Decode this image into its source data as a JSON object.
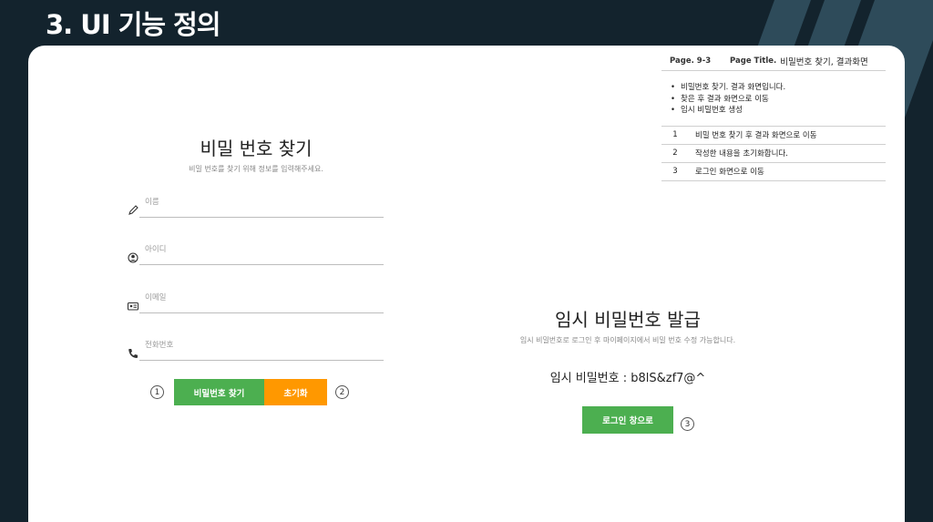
{
  "page_heading": "3. UI 기능 정의",
  "spec": {
    "page_label": "Page. 9-3",
    "page_title_label": "Page Title.",
    "page_title": "비밀번호 찾기, 결과화면",
    "notes": [
      "비밀번호 찾기. 결과 화면입니다.",
      "찾은 후 결과 화면으로 이동",
      "임시 비밀번호 생성"
    ],
    "rows": [
      {
        "num": "1",
        "desc": "비밀 번호 찾기 후 결과 화면으로 이동"
      },
      {
        "num": "2",
        "desc": "작성한 내용을 초기화합니다."
      },
      {
        "num": "3",
        "desc": "로그인 화면으로 이동"
      }
    ]
  },
  "find_form": {
    "title": "비밀 번호 찾기",
    "subtitle": "비밀 번호를 찾기 위해 정보를 입력해주세요.",
    "fields": [
      {
        "placeholder": "이름",
        "icon": "pencil-icon"
      },
      {
        "placeholder": "아이디",
        "icon": "user-circle-icon"
      },
      {
        "placeholder": "이메일",
        "icon": "id-card-icon"
      },
      {
        "placeholder": "전화번호",
        "icon": "phone-icon"
      }
    ],
    "find_button": "비밀번호 찾기",
    "reset_button": "초기화",
    "marker_1": "1",
    "marker_2": "2"
  },
  "result": {
    "title": "임시 비밀번호 발급",
    "subtitle": "임시 비밀번호로 로그인 후 마이페이지에서 비밀 번호 수정 가능합니다.",
    "password_line": "임시 비밀번호 : b8lS&zf7@^",
    "login_button": "로그인 창으로",
    "marker_3": "3"
  },
  "colors": {
    "green": "#4caf50",
    "orange": "#ff9800",
    "background": "#13232d"
  }
}
